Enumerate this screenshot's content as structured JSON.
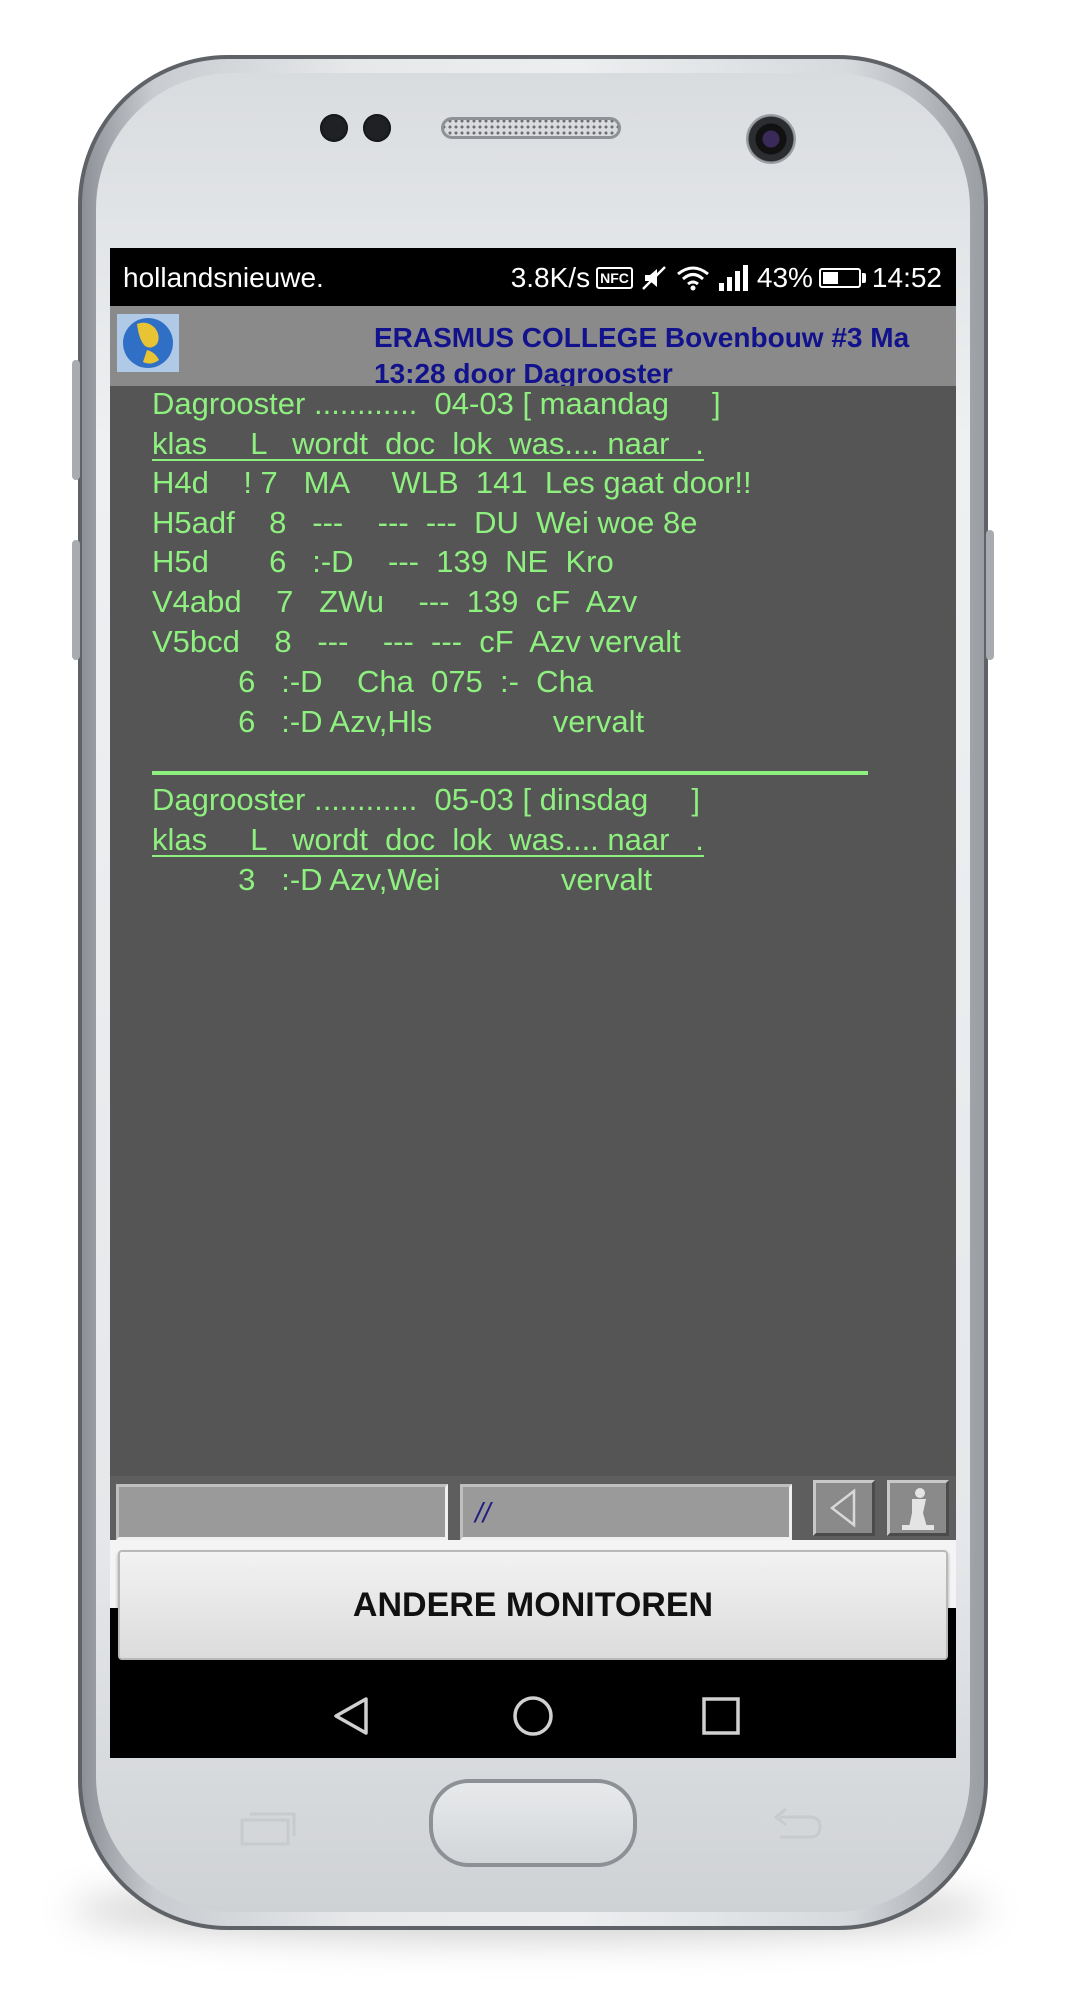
{
  "status_bar": {
    "carrier": "hollandsnieuwe.",
    "speed": "3.8K/s",
    "nfc": "NFC",
    "battery": "43%",
    "battery_level": 0.43,
    "time": "14:52"
  },
  "app_bar": {
    "title": "ERASMUS COLLEGE Bovenbouw #3  Ma",
    "subtitle": "13:28 door Dagrooster"
  },
  "schedule_lines": [
    "Dagrooster ............  04-03 [ maandag     ]",
    "klas     L   wordt  doc  lok  was.... naar   .",
    "H4d    ! 7   MA     WLB  141  Les gaat door!!",
    "H5adf    8   ---    ---  ---  DU  Wei woe 8e",
    "H5d       6   :-D    ---  139  NE  Kro",
    "V4abd    7   ZWu    ---  139  cF  Azv",
    "V5bcd    8   ---    ---  ---  cF  Azv vervalt",
    "          6   :-D    Cha  075  :-  Cha",
    "          6   :-D Azv,Hls              vervalt",
    "Dagrooster ............  05-03 [ dinsdag     ]",
    "klas     L   wordt  doc  lok  was.... naar   .",
    "          3   :-D Azv,Wei              vervalt"
  ],
  "inputs": {
    "left_value": "",
    "right_value": "//"
  },
  "buttons": {
    "other_monitors": "ANDERE MONITOREN"
  }
}
